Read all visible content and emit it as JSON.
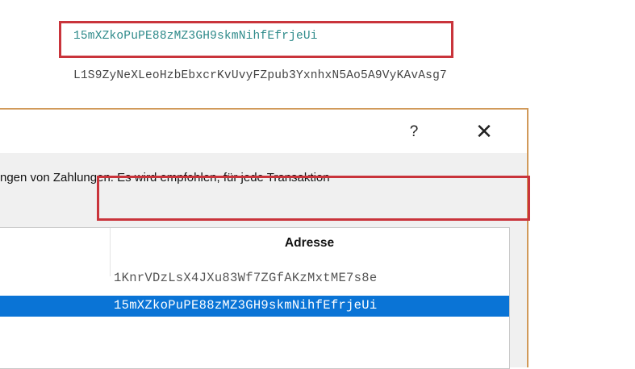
{
  "background": {
    "address_highlighted": "15mXZkoPuPE88zMZ3GH9skmNihfEfrjeUi",
    "private_key": "L1S9ZyNeXLeoHzbEbxcrKvUvyFZpub3YxnhxN5Ao5A9VyKAvAsg7"
  },
  "dialog": {
    "help_label": "?",
    "close_label": "✕",
    "description": "ngen von Zahlungen. Es wird empfohlen, für jede Transaktion",
    "table": {
      "header_address": "Adresse",
      "rows": [
        {
          "address": "1KnrVDzLsX4JXu83Wf7ZGfAKzMxtME7s8e",
          "selected": false
        },
        {
          "address": "15mXZkoPuPE88zMZ3GH9skmNihfEfrjeUi",
          "selected": true
        }
      ]
    }
  },
  "colors": {
    "highlight_box": "#c9343b",
    "selection": "#0a74d6",
    "address_teal": "#2e8a8a",
    "dialog_border": "#d19a5a"
  }
}
